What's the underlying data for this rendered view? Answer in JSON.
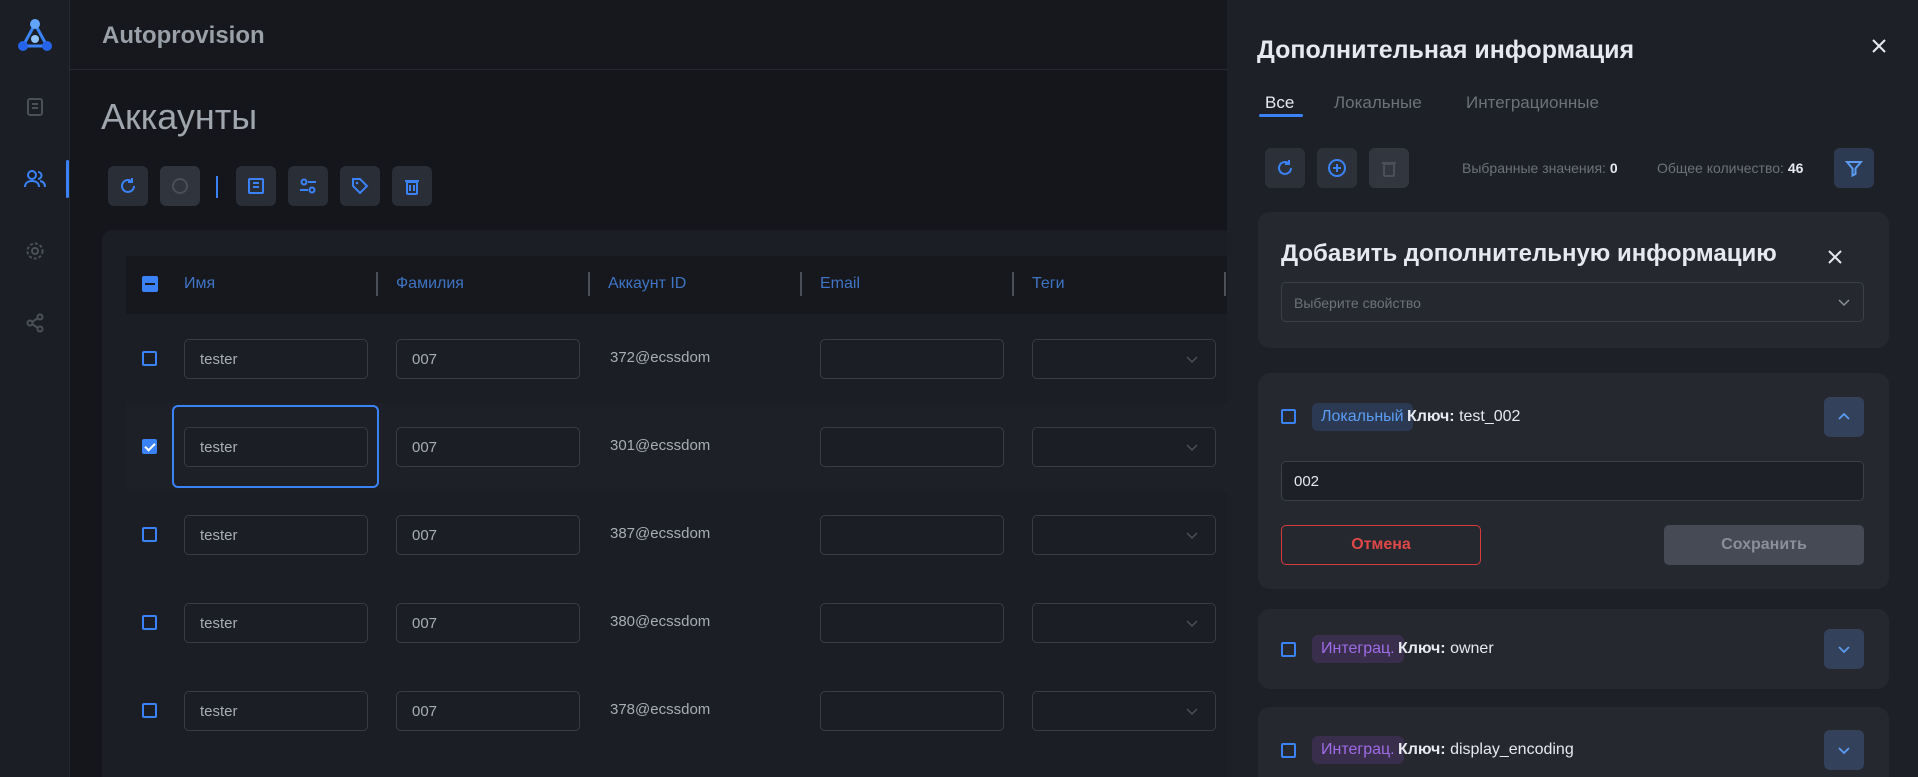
{
  "app": {
    "title": "Autoprovision"
  },
  "sidebar": {
    "items": [
      "phonebook-icon",
      "users-icon",
      "gear-icon",
      "share-icon"
    ],
    "active": "users-icon"
  },
  "page": {
    "title": "Аккаунты"
  },
  "table": {
    "columns": [
      "Имя",
      "Фамилия",
      "Аккаунт ID",
      "Email",
      "Теги"
    ],
    "rows": [
      {
        "first": "tester",
        "last": "007",
        "account": "372@ecssdom",
        "email": "",
        "checked": false
      },
      {
        "first": "tester",
        "last": "007",
        "account": "301@ecssdom",
        "email": "",
        "checked": true
      },
      {
        "first": "tester",
        "last": "007",
        "account": "387@ecssdom",
        "email": "",
        "checked": false
      },
      {
        "first": "tester",
        "last": "007",
        "account": "380@ecssdom",
        "email": "",
        "checked": false
      },
      {
        "first": "tester",
        "last": "007",
        "account": "378@ecssdom",
        "email": "",
        "checked": false
      }
    ]
  },
  "panel": {
    "title": "Дополнительная информация",
    "tabs": [
      "Все",
      "Локальные",
      "Интеграционные"
    ],
    "active_tab": "Все",
    "selected_label": "Выбранные значения:",
    "selected_value": "0",
    "total_label": "Общее количество:",
    "total_value": "46",
    "add_card": {
      "title": "Добавить дополнительную информацию",
      "placeholder": "Выберите свойство"
    },
    "items": [
      {
        "badge": "Локальный",
        "key_label": "Ключ:",
        "key": "test_002",
        "value": "002",
        "expanded": true,
        "cancel": "Отмена",
        "save": "Сохранить"
      },
      {
        "badge": "Интеграц.",
        "key_label": "Ключ:",
        "key": "owner",
        "expanded": false
      },
      {
        "badge": "Интеграц.",
        "key_label": "Ключ:",
        "key": "display_encoding",
        "expanded": false
      }
    ]
  },
  "colors": {
    "accent": "#3b82f6",
    "danger": "#e04848",
    "local_badge": "#5b9cf2",
    "integ_badge": "#a06be6"
  }
}
